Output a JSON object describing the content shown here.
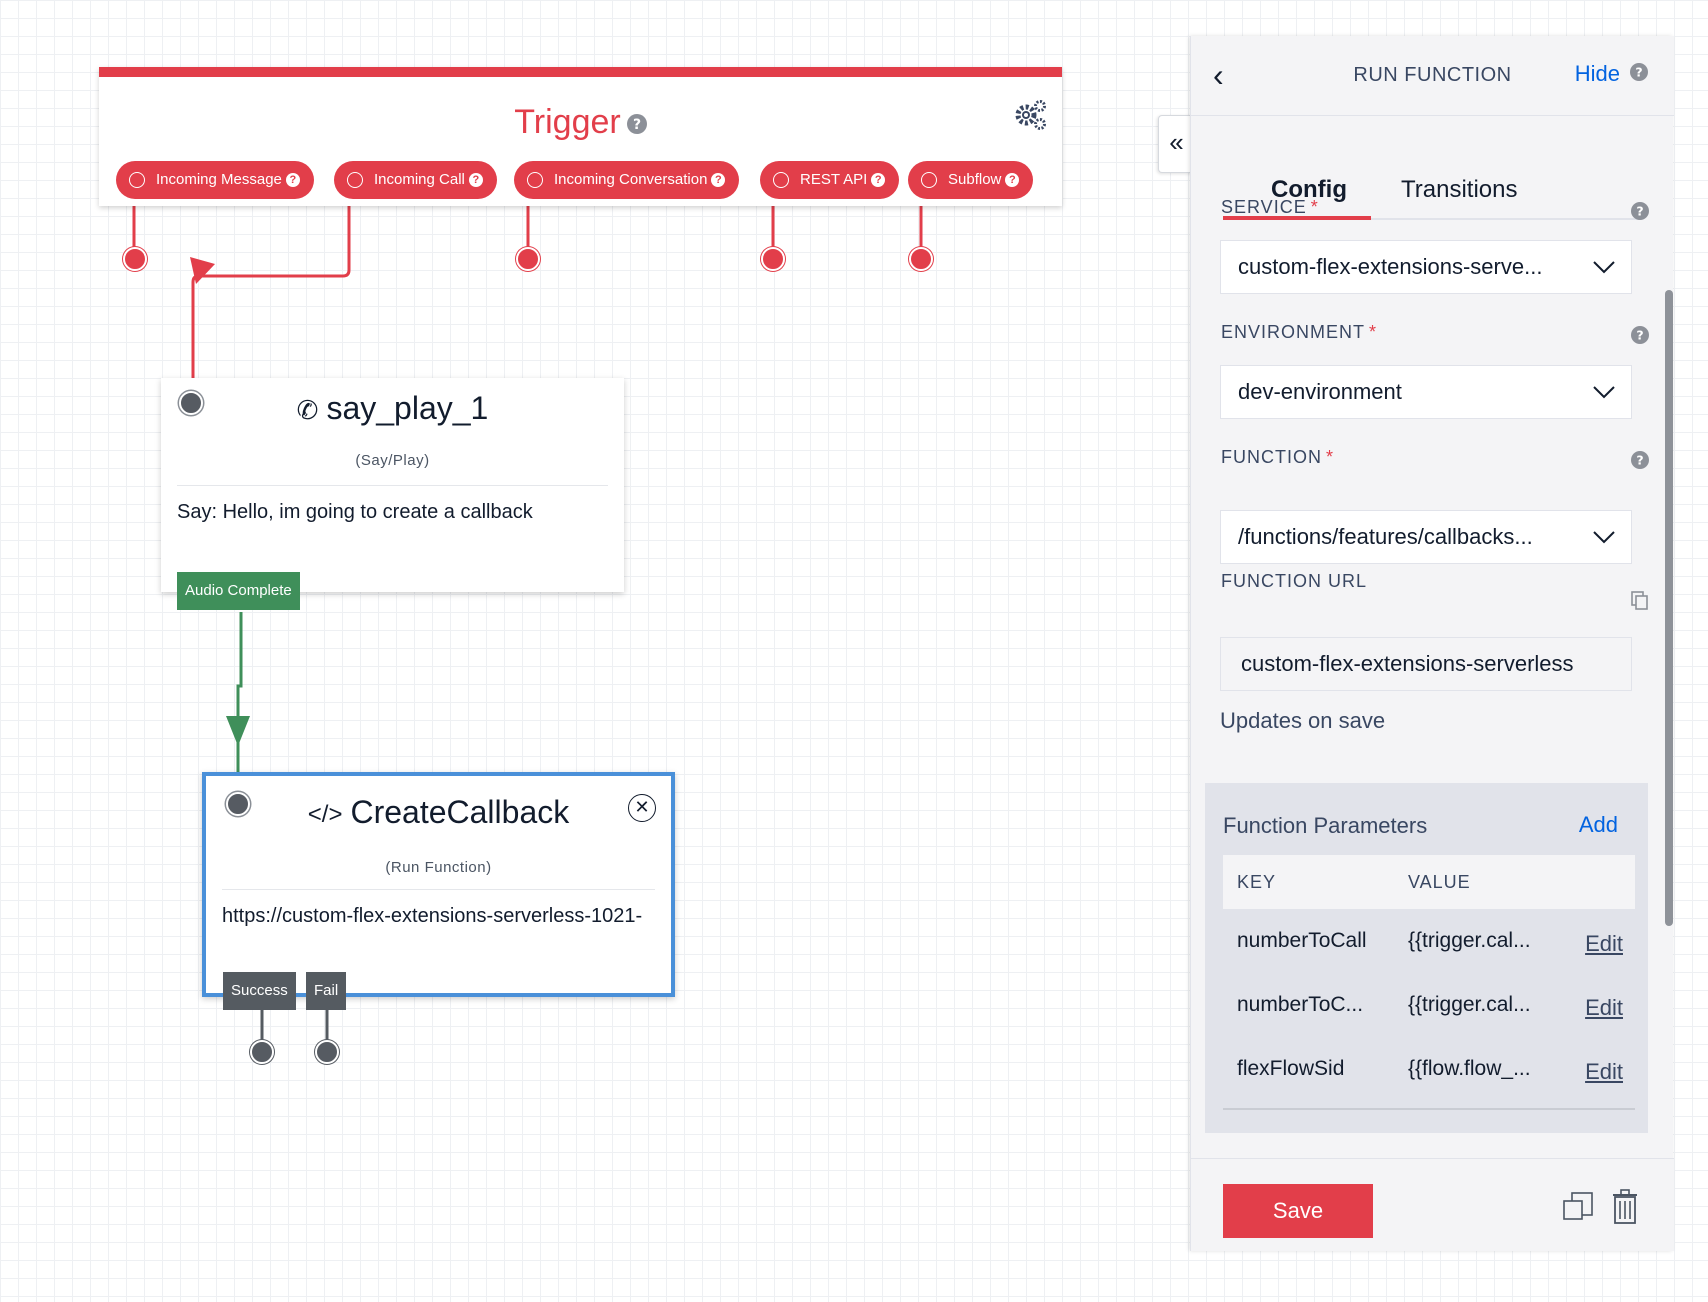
{
  "trigger": {
    "title": "Trigger",
    "pills": [
      {
        "label": "Incoming Message"
      },
      {
        "label": "Incoming Call"
      },
      {
        "label": "Incoming Conversation"
      },
      {
        "label": "REST API"
      },
      {
        "label": "Subflow"
      }
    ]
  },
  "say_play": {
    "name": "say_play_1",
    "type": "(Say/Play)",
    "body": "Say: Hello, im going to create a callback",
    "transition": "Audio Complete"
  },
  "create_callback": {
    "name": "CreateCallback",
    "type": "(Run Function)",
    "body": "https://custom-flex-extensions-serverless-1021-",
    "transitions": [
      "Success",
      "Fail"
    ]
  },
  "panel": {
    "title": "RUN FUNCTION",
    "hide_label": "Hide",
    "tabs": [
      "Config",
      "Transitions"
    ],
    "active_tab": "Config",
    "service": {
      "label": "SERVICE",
      "required": "*",
      "value": "custom-flex-extensions-serve..."
    },
    "environment": {
      "label": "ENVIRONMENT",
      "required": "*",
      "value": "dev-environment"
    },
    "function": {
      "label": "FUNCTION",
      "required": "*",
      "value": "/functions/features/callbacks..."
    },
    "function_url": {
      "label": "FUNCTION URL",
      "value": "custom-flex-extensions-serverless",
      "note": "Updates on save"
    },
    "parameters": {
      "title": "Function Parameters",
      "add_label": "Add",
      "key_header": "KEY",
      "value_header": "VALUE",
      "rows": [
        {
          "key": "numberToCall",
          "value": "{{trigger.cal...",
          "action": "Edit"
        },
        {
          "key": "numberToC...",
          "value": "{{trigger.cal...",
          "action": "Edit"
        },
        {
          "key": "flexFlowSid",
          "value": "{{flow.flow_...",
          "action": "Edit"
        }
      ]
    },
    "save_label": "Save"
  },
  "colors": {
    "trigger_red": "#e23e4a",
    "success_green": "#3f8f5a",
    "link_blue": "#0263e0",
    "selected_border": "#4a90d9"
  }
}
